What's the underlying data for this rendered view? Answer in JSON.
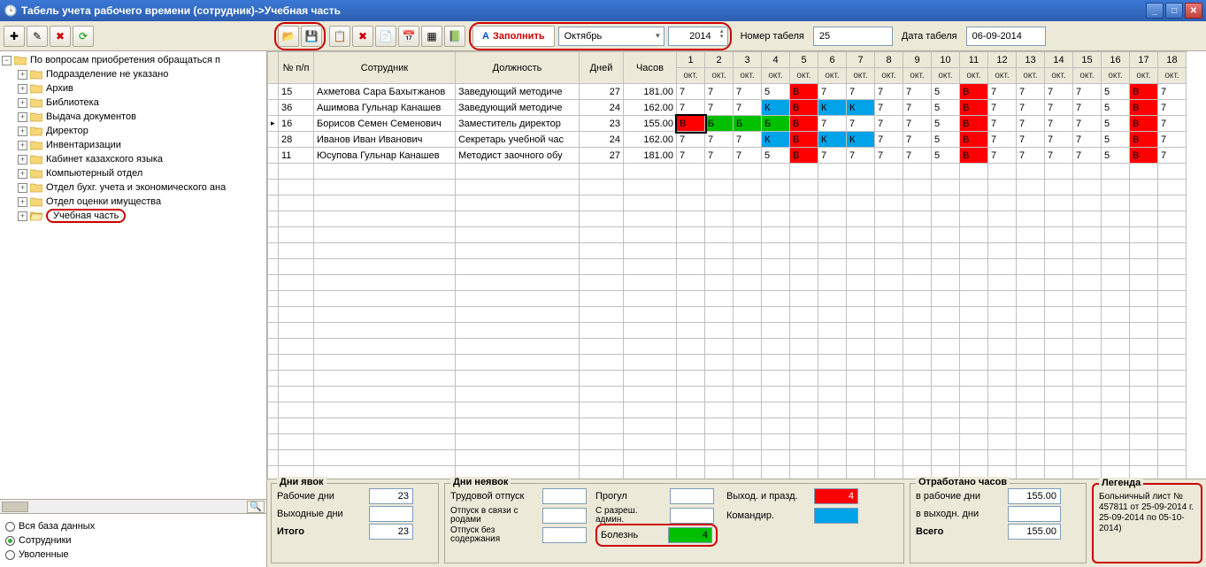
{
  "titlebar": {
    "text": "Табель учета рабочего времени (сотрудник)->Учебная часть"
  },
  "toolbar": {
    "fill_label": "Заполнить",
    "month": "Октябрь",
    "year": "2014",
    "num_label": "Номер табеля",
    "num_value": "25",
    "date_label": "Дата табеля",
    "date_value": "06-09-2014"
  },
  "tree": {
    "root": "По вопросам приобретения обращаться п",
    "items": [
      "Подразделение не указано",
      "Архив",
      "Библиотека",
      "Выдача документов",
      "Директор",
      "Инвентаризации",
      "Кабинет казахского языка",
      "Компьютерный отдел",
      "Отдел бухг. учета и экономического ана",
      "Отдел оценки имущества",
      "Учебная часть"
    ],
    "selected_index": 10
  },
  "radios": {
    "r1": "Вся база данных",
    "r2": "Сотрудники",
    "r3": "Уволенные",
    "checked": 1
  },
  "grid": {
    "headers": [
      "№ п/п",
      "Сотрудник",
      "Должность",
      "Дней",
      "Часов"
    ],
    "days": [
      1,
      2,
      3,
      4,
      5,
      6,
      7,
      8,
      9,
      10,
      11,
      12,
      13,
      14,
      15,
      16,
      17,
      18
    ],
    "day_sub": "окт.",
    "rows": [
      {
        "marker": "",
        "n": "15",
        "emp": "Ахметова Сара Бахытжанов",
        "pos": "Заведующий методиче",
        "d": "27",
        "h": "181.00",
        "cells": [
          "7",
          "7",
          "7",
          "5",
          "В",
          "7",
          "7",
          "7",
          "7",
          "5",
          "В",
          "7",
          "7",
          "7",
          "7",
          "5",
          "В",
          "7"
        ]
      },
      {
        "marker": "",
        "n": "36",
        "emp": "Ашимова Гульнар Канашев",
        "pos": "Заведующий методиче",
        "d": "24",
        "h": "162.00",
        "cells": [
          "7",
          "7",
          "7",
          "К",
          "В",
          "К",
          "К",
          "7",
          "7",
          "5",
          "В",
          "7",
          "7",
          "7",
          "7",
          "5",
          "В",
          "7"
        ]
      },
      {
        "marker": "▸",
        "n": "16",
        "emp": "Борисов Семен Семенович",
        "pos": "Заместитель директор",
        "d": "23",
        "h": "155.00",
        "cells": [
          "В",
          "Б",
          "Б",
          "Б",
          "В",
          "7",
          "7",
          "7",
          "7",
          "5",
          "В",
          "7",
          "7",
          "7",
          "7",
          "5",
          "В",
          "7"
        ],
        "edit": 0
      },
      {
        "marker": "",
        "n": "28",
        "emp": "Иванов Иван Иванович",
        "pos": "Секретарь учебной час",
        "d": "24",
        "h": "162.00",
        "cells": [
          "7",
          "7",
          "7",
          "К",
          "В",
          "К",
          "К",
          "7",
          "7",
          "5",
          "В",
          "7",
          "7",
          "7",
          "7",
          "5",
          "В",
          "7"
        ]
      },
      {
        "marker": "",
        "n": "11",
        "emp": "Юсупова Гульнар Канашев",
        "pos": "Методист заочного обу",
        "d": "27",
        "h": "181.00",
        "cells": [
          "7",
          "7",
          "7",
          "5",
          "В",
          "7",
          "7",
          "7",
          "7",
          "5",
          "В",
          "7",
          "7",
          "7",
          "7",
          "5",
          "В",
          "7"
        ]
      }
    ]
  },
  "bottom": {
    "attendance": {
      "legend": "Дни явок",
      "work_days_l": "Рабочие дни",
      "work_days_v": "23",
      "off_days_l": "Выходные дни",
      "off_days_v": "",
      "total_l": "Итого",
      "total_v": "23"
    },
    "absence": {
      "legend": "Дни неявок",
      "vac_l": "Трудовой отпуск",
      "vac_v": "",
      "mat_l": "Отпуск в связи с родами",
      "mat_v": "",
      "unp_l": "Отпуск без содержания",
      "unp_v": "",
      "absent_l": "Прогул",
      "absent_v": "",
      "admin_l": "С разреш. админ.",
      "admin_v": "",
      "ill_l": "Болезнь",
      "ill_v": "4",
      "hol_l": "Выход. и празд.",
      "hol_v": "4",
      "trip_l": "Командир.",
      "trip_v": ""
    },
    "worked": {
      "legend": "Отработано часов",
      "wd_l": "в рабочие дни",
      "wd_v": "155.00",
      "we_l": "в выходн. дни",
      "we_v": "",
      "tot_l": "Всего",
      "tot_v": "155.00"
    },
    "legendbox": {
      "legend": "Легенда",
      "text": "Больничный лист № 457811 от 25-09-2014 г. 25-09-2014 по 05-10-2014)"
    }
  }
}
